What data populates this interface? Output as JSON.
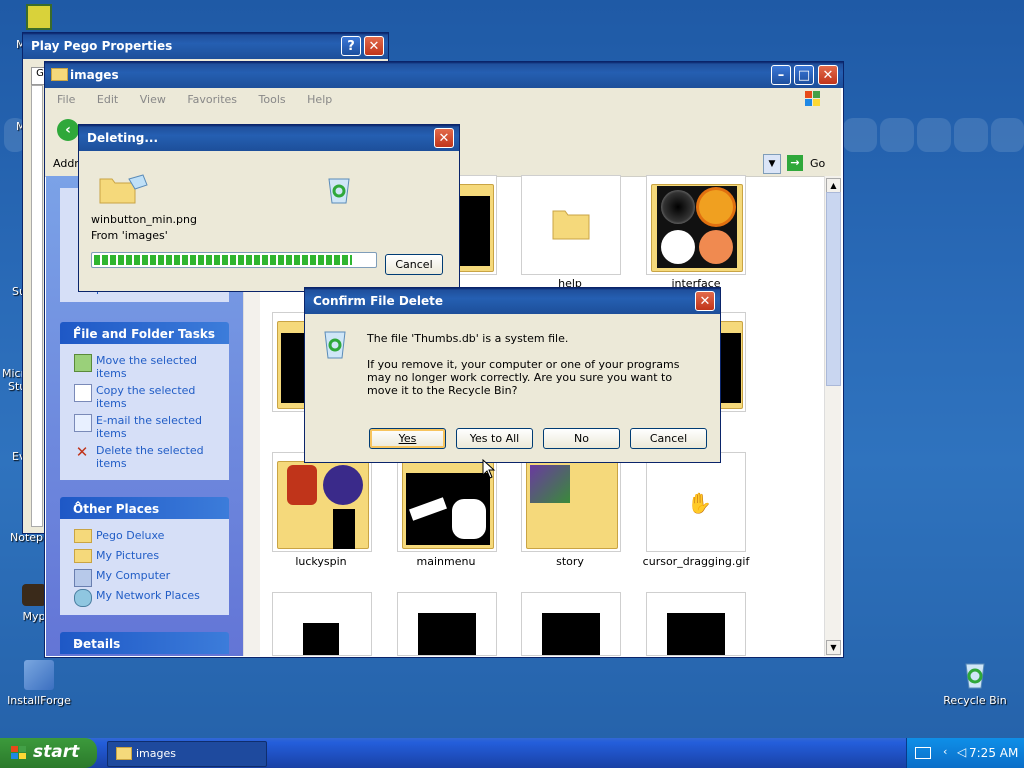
{
  "desktop": {
    "icons": [
      {
        "label": "InstallForge",
        "icon": "installforge-icon"
      },
      {
        "label": "Myp",
        "icon": "mypictures-icon"
      },
      {
        "label": "Recycle Bin",
        "icon": "recycle-bin-icon"
      }
    ],
    "fragments": [
      "M",
      "M",
      "Su",
      "Micro",
      "Stu",
      "Ev",
      "Notep"
    ]
  },
  "properties_window": {
    "title": "Play Pego Properties",
    "help_glyph": "?",
    "close_glyph": "✕",
    "tab_fragment": "G"
  },
  "explorer": {
    "title": "images",
    "menu": [
      "File",
      "Edit",
      "View",
      "Favorites",
      "Tools",
      "Help"
    ],
    "address_fragment": "Addre",
    "go_label": "Go",
    "panel_fragment": "pictures",
    "file_tasks": {
      "header": "File and Folder Tasks",
      "items": [
        "Move the selected items",
        "Copy the selected items",
        "E-mail the selected items",
        "Delete the selected items"
      ]
    },
    "other_places": {
      "header": "Other Places",
      "items": [
        "Pego Deluxe",
        "My Pictures",
        "My Computer",
        "My Network Places"
      ]
    },
    "details": {
      "header": "Details"
    },
    "thumbnails": [
      {
        "label": "help"
      },
      {
        "label": "interface"
      },
      {
        "label": "luckyspin"
      },
      {
        "label": "mainmenu"
      },
      {
        "label": "story"
      },
      {
        "label": "cursor_dragging.gif"
      }
    ]
  },
  "deleting_dialog": {
    "title": "Deleting...",
    "filename": "winbutton_min.png",
    "from_text": "From 'images'",
    "progress": 0.92,
    "cancel_label": "Cancel"
  },
  "confirm_dialog": {
    "title": "Confirm File Delete",
    "line1": "The file 'Thumbs.db' is a system file.",
    "line2": "If you remove it, your computer or one of your programs may no longer work correctly. Are you sure you want to move it to the Recycle Bin?",
    "buttons": {
      "yes": "Yes",
      "yes_to_all": "Yes to All",
      "no": "No",
      "cancel": "Cancel"
    }
  },
  "taskbar": {
    "start_label": "start",
    "task_item": "images",
    "clock": "7:25 AM"
  },
  "colors": {
    "accent": "#0a246a",
    "link": "#215dc6",
    "progress": "#2fb52f",
    "close_red": "#c0341a"
  }
}
